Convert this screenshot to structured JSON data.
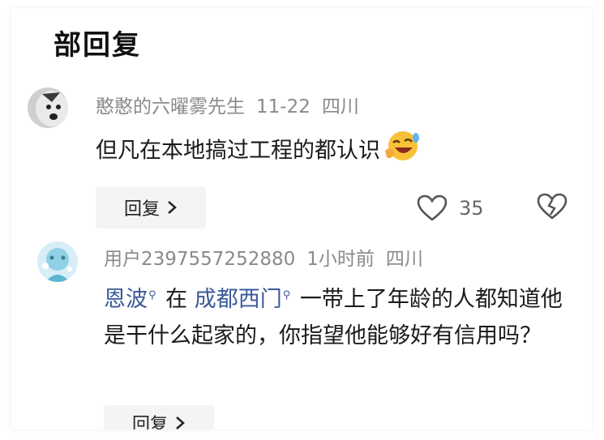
{
  "header": {
    "title": "部回复"
  },
  "comments": [
    {
      "username": "憨憨的六曜雾先生",
      "date": "11-22",
      "location": "四川",
      "text": "但凡在本地搞过工程的都认识",
      "emoji": "laughing-crying-emoji",
      "reply_label": "回复",
      "like_count": "35"
    },
    {
      "username": "用户2397557252880",
      "time": "1小时前",
      "location": "四川",
      "mention1": "恩波",
      "text_part1": "在",
      "mention2": "成都西门",
      "text_part2": "一带上了年龄的人都知道他是干什么起家的，你指望他能够好有信用吗？",
      "reply_label": "回复"
    }
  ],
  "colors": {
    "mention": "#3b5998",
    "meta": "#8a8a8a",
    "button_bg": "#f4f4f4"
  }
}
